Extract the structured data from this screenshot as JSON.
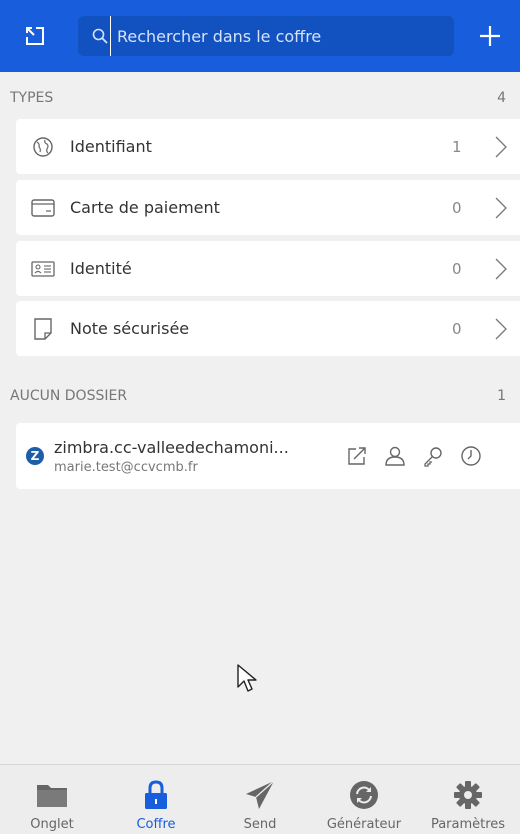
{
  "colors": {
    "brand": "#175ddc",
    "background": "#f0f0f0",
    "card": "#ffffff",
    "muted": "#777777",
    "icon": "#666666"
  },
  "header": {
    "popout_icon": "popout-icon",
    "search_placeholder": "Rechercher dans le coffre",
    "add_icon": "plus-icon"
  },
  "types": {
    "title": "TYPES",
    "count": "4",
    "items": [
      {
        "label": "Identifiant",
        "count": "1",
        "icon": "globe-icon"
      },
      {
        "label": "Carte de paiement",
        "count": "0",
        "icon": "credit-card-icon"
      },
      {
        "label": "Identité",
        "count": "0",
        "icon": "id-card-icon"
      },
      {
        "label": "Note sécurisée",
        "count": "0",
        "icon": "sticky-note-icon"
      }
    ]
  },
  "no_folder": {
    "title": "AUCUN DOSSIER",
    "count": "1",
    "items": [
      {
        "favicon_letter": "Z",
        "name": "zimbra.cc-valleedechamoni...",
        "username": "marie.test@ccvcmb.fr",
        "actions": [
          "launch-icon",
          "user-icon",
          "key-icon",
          "clock-icon"
        ]
      }
    ]
  },
  "nav": {
    "items": [
      {
        "label": "Onglet",
        "icon": "folder-icon",
        "active": false
      },
      {
        "label": "Coffre",
        "icon": "lock-icon",
        "active": true
      },
      {
        "label": "Send",
        "icon": "paper-plane-icon",
        "active": false
      },
      {
        "label": "Générateur",
        "icon": "refresh-icon",
        "active": false
      },
      {
        "label": "Paramètres",
        "icon": "gear-icon",
        "active": false
      }
    ]
  }
}
